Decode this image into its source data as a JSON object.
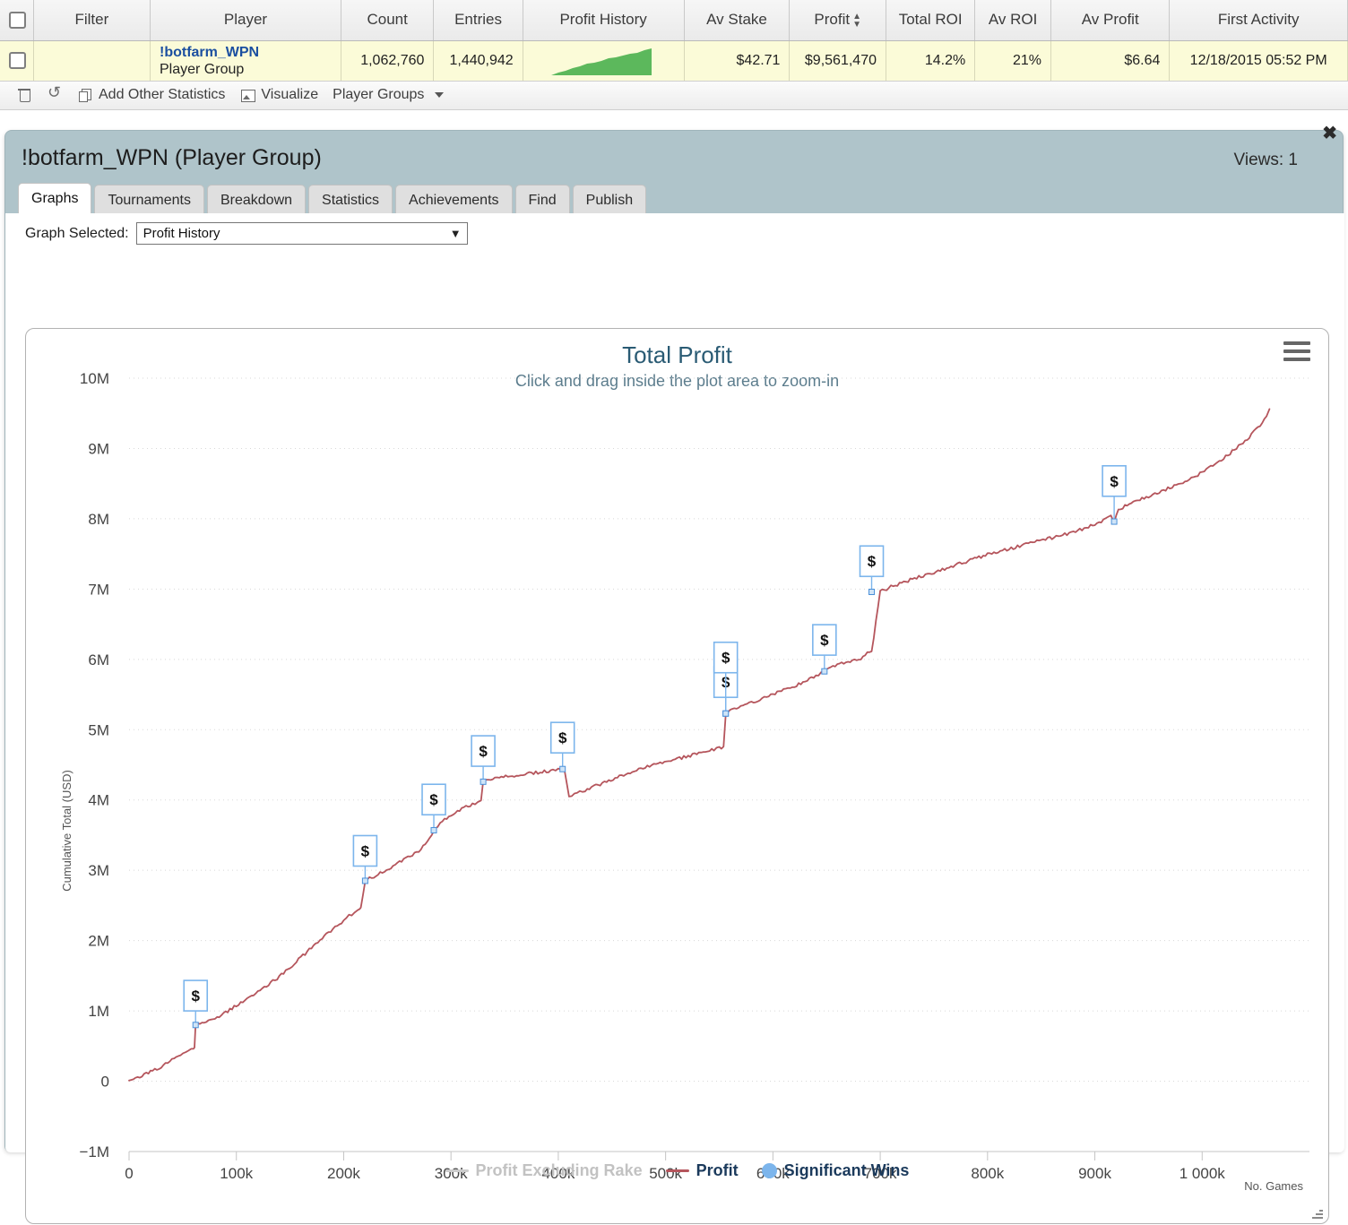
{
  "table": {
    "columns": [
      "Filter",
      "Player",
      "Count",
      "Entries",
      "Profit History",
      "Av Stake",
      "Profit",
      "Total ROI",
      "Av ROI",
      "Av Profit",
      "First Activity"
    ],
    "sorted_column": "Profit",
    "rows": [
      {
        "filter": "",
        "player_name": "!botfarm_WPN",
        "player_type": "Player Group",
        "count": "1,062,760",
        "entries": "1,440,942",
        "profit_history": "sparkline-area",
        "av_stake": "$42.71",
        "profit": "$9,561,470",
        "total_roi": "14.2%",
        "av_roi": "21%",
        "av_profit": "$6.64",
        "first_activity": "12/18/2015 05:52 PM"
      }
    ]
  },
  "actionbar": {
    "delete_icon": "trash-icon",
    "refresh_icon": "refresh-icon",
    "copy_icon": "copy-icon",
    "add_stats_label": "Add Other Statistics",
    "visualize_icon": "image-icon",
    "visualize_label": "Visualize",
    "player_groups_label": "Player Groups"
  },
  "panel": {
    "title": "!botfarm_WPN (Player Group)",
    "views": "Views: 1",
    "close_icon": "close-icon",
    "tabs": [
      {
        "label": "Graphs",
        "active": true
      },
      {
        "label": "Tournaments",
        "active": false
      },
      {
        "label": "Breakdown",
        "active": false
      },
      {
        "label": "Statistics",
        "active": false
      },
      {
        "label": "Achievements",
        "active": false
      },
      {
        "label": "Find",
        "active": false
      },
      {
        "label": "Publish",
        "active": false
      }
    ],
    "graph_selector": {
      "label": "Graph Selected:",
      "value": "Profit History",
      "options": [
        "Profit History"
      ]
    }
  },
  "chart_data": {
    "type": "line",
    "title": "Total Profit",
    "subtitle": "Click and drag inside the plot area to zoom-in",
    "xlabel": "No. Games",
    "ylabel": "Cumulative Total (USD)",
    "xlim": [
      0,
      1100000
    ],
    "ylim": [
      -1000000,
      10000000
    ],
    "xticks": [
      0,
      100000,
      200000,
      300000,
      400000,
      500000,
      600000,
      700000,
      800000,
      900000,
      1000000
    ],
    "xticklabels": [
      "0",
      "100k",
      "200k",
      "300k",
      "400k",
      "500k",
      "600k",
      "700k",
      "800k",
      "900k",
      "1 000k"
    ],
    "yticks": [
      -1000000,
      0,
      1000000,
      2000000,
      3000000,
      4000000,
      5000000,
      6000000,
      7000000,
      8000000,
      9000000,
      10000000
    ],
    "yticklabels": [
      "−1M",
      "0",
      "1M",
      "2M",
      "3M",
      "4M",
      "5M",
      "6M",
      "7M",
      "8M",
      "9M",
      "10M"
    ],
    "grid": true,
    "legend_position": "bottom",
    "colors": {
      "profit": "#b5555c",
      "profit_excluding_rake": "#cccccc",
      "significant_wins": "#7cb5ec",
      "title": "#2a5b74"
    },
    "legend": [
      {
        "name": "Profit Excluding Rake",
        "marker": "line",
        "color": "#cccccc",
        "enabled": false
      },
      {
        "name": "Profit",
        "marker": "line",
        "color": "#b5555c",
        "enabled": true
      },
      {
        "name": "Significant Wins",
        "marker": "circle",
        "color": "#7cb5ec",
        "enabled": true
      }
    ],
    "series": [
      {
        "name": "Profit",
        "color": "#b5555c",
        "x": [
          0,
          10000,
          20000,
          30000,
          40000,
          48000,
          55000,
          58000,
          60000,
          61000,
          62000,
          70000,
          80000,
          90000,
          100000,
          110000,
          120000,
          130000,
          140000,
          150000,
          160000,
          170000,
          180000,
          190000,
          200000,
          205000,
          210000,
          213000,
          215000,
          216000,
          220000,
          230000,
          240000,
          250000,
          260000,
          270000,
          278000,
          282000,
          284000,
          285000,
          290000,
          300000,
          310000,
          320000,
          325000,
          328000,
          330000,
          335000,
          345000,
          355000,
          365000,
          375000,
          385000,
          395000,
          400000,
          404000,
          406000,
          410000,
          415000,
          420000,
          425000,
          435000,
          445000,
          455000,
          465000,
          475000,
          485000,
          495000,
          505000,
          515000,
          525000,
          535000,
          545000,
          550000,
          552000,
          554000,
          556000,
          560000,
          570000,
          580000,
          590000,
          600000,
          610000,
          620000,
          630000,
          640000,
          645000,
          648000,
          650000,
          660000,
          670000,
          680000,
          686000,
          688000,
          690000,
          692000,
          700000,
          710000,
          720000,
          730000,
          740000,
          750000,
          760000,
          770000,
          780000,
          790000,
          800000,
          810000,
          820000,
          830000,
          840000,
          850000,
          860000,
          870000,
          880000,
          890000,
          900000,
          908000,
          912000,
          915000,
          918000,
          922000,
          930000,
          940000,
          950000,
          960000,
          970000,
          980000,
          990000,
          1000000,
          1010000,
          1020000,
          1030000,
          1040000,
          1050000,
          1060000,
          1062760
        ],
        "y": [
          0,
          60000,
          130000,
          210000,
          300000,
          370000,
          430000,
          450000,
          460000,
          480000,
          800000,
          830000,
          900000,
          980000,
          1070000,
          1160000,
          1260000,
          1370000,
          1490000,
          1620000,
          1760000,
          1900000,
          2030000,
          2160000,
          2290000,
          2350000,
          2400000,
          2420000,
          2440000,
          2460000,
          2850000,
          2930000,
          3010000,
          3090000,
          3180000,
          3280000,
          3400000,
          3500000,
          3570000,
          3590000,
          3680000,
          3790000,
          3870000,
          3940000,
          3980000,
          4010000,
          4260000,
          4290000,
          4320000,
          4340000,
          4360000,
          4380000,
          4400000,
          4420000,
          4430000,
          4440000,
          4390000,
          4060000,
          4080000,
          4110000,
          4140000,
          4200000,
          4260000,
          4320000,
          4380000,
          4430000,
          4480000,
          4520000,
          4560000,
          4600000,
          4640000,
          4680000,
          4720000,
          4740000,
          4750000,
          4760000,
          5230000,
          5260000,
          5320000,
          5380000,
          5440000,
          5500000,
          5560000,
          5620000,
          5690000,
          5760000,
          5800000,
          5830000,
          5870000,
          5920000,
          5960000,
          6000000,
          6060000,
          6120000,
          6080000,
          6100000,
          6960000,
          7030000,
          7090000,
          7140000,
          7190000,
          7240000,
          7290000,
          7340000,
          7390000,
          7440000,
          7490000,
          7530000,
          7570000,
          7610000,
          7650000,
          7690000,
          7730000,
          7770000,
          7810000,
          7860000,
          7920000,
          7980000,
          8020000,
          8060000,
          7960000,
          8130000,
          8200000,
          8260000,
          8320000,
          8380000,
          8440000,
          8500000,
          8580000,
          8660000,
          8760000,
          8860000,
          8980000,
          9110000,
          9260000,
          9440000,
          9561470
        ]
      }
    ],
    "annotations": [
      {
        "label": "$",
        "x": 62000,
        "y": 800000,
        "flag_y": 1000000
      },
      {
        "label": "$",
        "x": 220000,
        "y": 2850000,
        "flag_y": 3060000
      },
      {
        "label": "$",
        "x": 284000,
        "y": 3570000,
        "flag_y": 3790000
      },
      {
        "label": "$",
        "x": 330000,
        "y": 4260000,
        "flag_y": 4480000
      },
      {
        "label": "$",
        "x": 404000,
        "y": 4440000,
        "flag_y": 4670000
      },
      {
        "label": "$",
        "x": 556000,
        "y": 5230000,
        "flag_y": 5460000
      },
      {
        "label": "$",
        "x": 556000,
        "y": 5230000,
        "flag_y": 5810000
      },
      {
        "label": "$",
        "x": 648000,
        "y": 5830000,
        "flag_y": 6060000
      },
      {
        "label": "$",
        "x": 692000,
        "y": 6960000,
        "flag_y": 7180000
      },
      {
        "label": "$",
        "x": 918000,
        "y": 7960000,
        "flag_y": 8320000
      }
    ]
  }
}
